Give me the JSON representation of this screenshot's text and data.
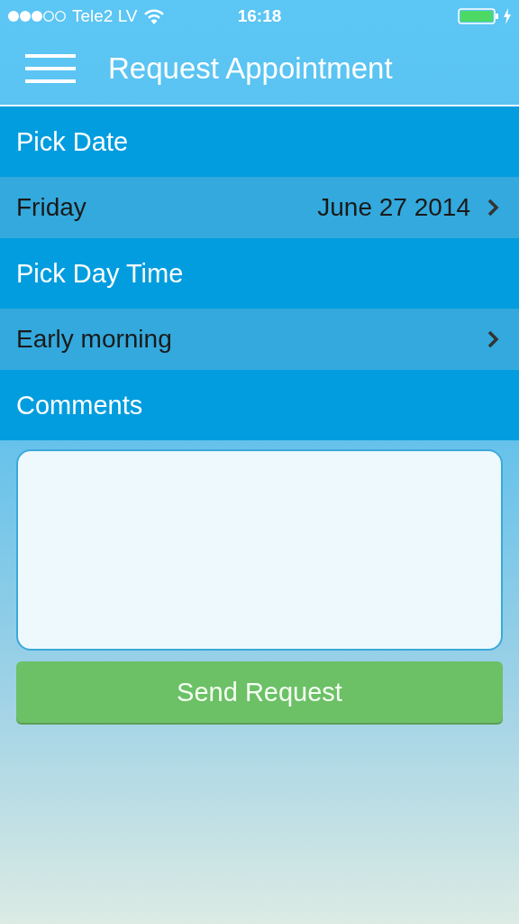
{
  "status_bar": {
    "carrier": "Tele2 LV",
    "time": "16:18"
  },
  "nav_bar": {
    "title": "Request Appointment"
  },
  "sections": [
    {
      "kind": "header",
      "label": "Pick Date"
    },
    {
      "kind": "picker",
      "label": "Friday",
      "value": "June 27 2014"
    },
    {
      "kind": "header",
      "label": "Pick Day Time"
    },
    {
      "kind": "picker",
      "label": "Early morning"
    },
    {
      "kind": "header",
      "label": "Comments"
    }
  ],
  "submit_button": "Send Request"
}
